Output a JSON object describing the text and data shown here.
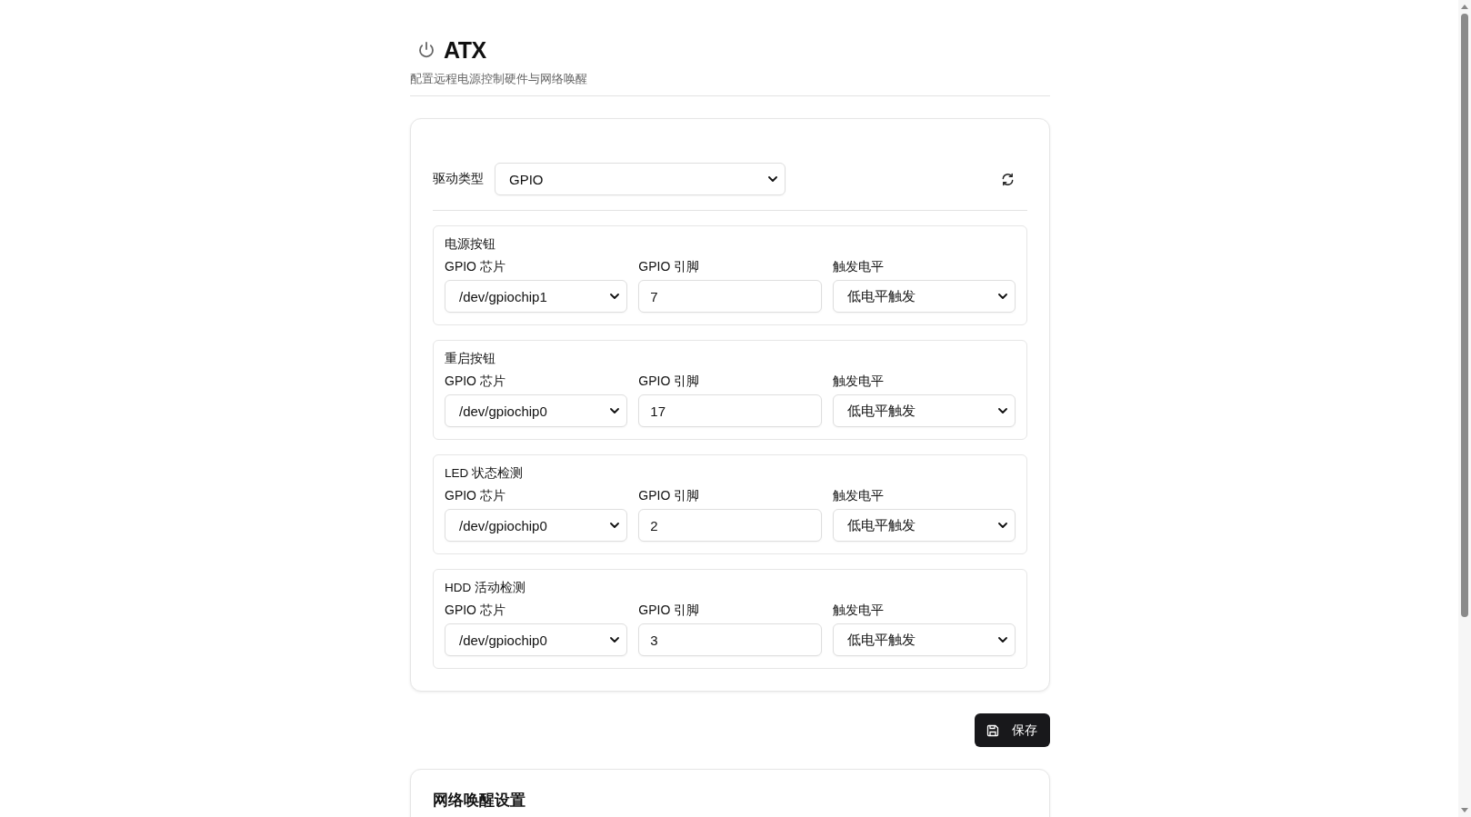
{
  "header": {
    "title": "ATX",
    "subtitle": "配置远程电源控制硬件与网络唤醒"
  },
  "driver": {
    "label": "驱动类型",
    "value": "GPIO"
  },
  "sections": [
    {
      "title": "电源按钮",
      "fields": [
        {
          "kind": "select",
          "label": "GPIO 芯片",
          "value": "/dev/gpiochip1"
        },
        {
          "kind": "input",
          "label": "GPIO 引脚",
          "value": "7"
        },
        {
          "kind": "select",
          "label": "触发电平",
          "value": "低电平触发"
        }
      ]
    },
    {
      "title": "重启按钮",
      "fields": [
        {
          "kind": "select",
          "label": "GPIO 芯片",
          "value": "/dev/gpiochip0"
        },
        {
          "kind": "input",
          "label": "GPIO 引脚",
          "value": "17"
        },
        {
          "kind": "select",
          "label": "触发电平",
          "value": "低电平触发"
        }
      ]
    },
    {
      "title": "LED 状态检测",
      "fields": [
        {
          "kind": "select",
          "label": "GPIO 芯片",
          "value": "/dev/gpiochip0"
        },
        {
          "kind": "input",
          "label": "GPIO 引脚",
          "value": "2"
        },
        {
          "kind": "select",
          "label": "触发电平",
          "value": "低电平触发"
        }
      ]
    },
    {
      "title": "HDD 活动检测",
      "fields": [
        {
          "kind": "select",
          "label": "GPIO 芯片",
          "value": "/dev/gpiochip0"
        },
        {
          "kind": "input",
          "label": "GPIO 引脚",
          "value": "3"
        },
        {
          "kind": "select",
          "label": "触发电平",
          "value": "低电平触发"
        }
      ]
    }
  ],
  "save_button": {
    "label": "保存"
  },
  "wol_card": {
    "title": "网络唤醒设置"
  }
}
